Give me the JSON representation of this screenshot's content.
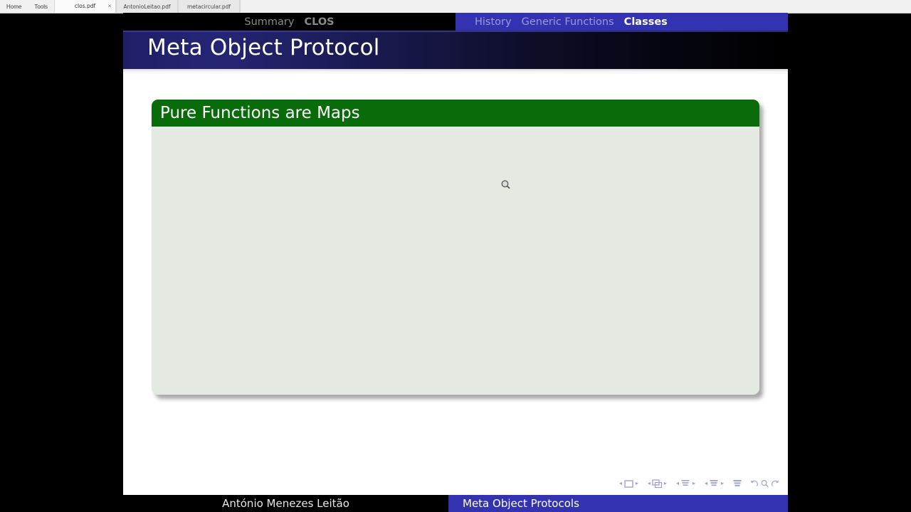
{
  "app": {
    "menu": [
      {
        "label": "Home",
        "name": "menu-home"
      },
      {
        "label": "Tools",
        "name": "menu-tools"
      }
    ],
    "tabs": [
      {
        "label": "clos.pdf",
        "active": true,
        "close": "×"
      },
      {
        "label": "AntonioLeitao.pdf",
        "active": false,
        "close": ""
      },
      {
        "label": "metacircular.pdf",
        "active": false,
        "close": ""
      }
    ]
  },
  "slide": {
    "navigation": {
      "sections": [
        {
          "label": "Summary",
          "active": false
        },
        {
          "label": "CLOS",
          "active": true
        }
      ],
      "subsections": [
        {
          "label": "History",
          "active": false
        },
        {
          "label": "Generic Functions",
          "active": false
        },
        {
          "label": "Classes",
          "active": true
        }
      ]
    },
    "frame_title": "Meta Object Protocol",
    "block": {
      "title": "Pure Functions are Maps",
      "body": ""
    },
    "footer": {
      "author": "António Menezes Leitão",
      "title": "Meta Object Protocols"
    },
    "nav_symbols": [
      {
        "name": "slide-navigation",
        "icon": "rectangle"
      },
      {
        "name": "frame-navigation",
        "icon": "stacked-rectangles"
      },
      {
        "name": "subsection-navigation",
        "icon": "lines-small"
      },
      {
        "name": "section-navigation",
        "icon": "lines-medium"
      },
      {
        "name": "document-navigation",
        "icon": "lines-large"
      },
      {
        "name": "back-navigation",
        "icon": "undo-arrow"
      },
      {
        "name": "search-navigation",
        "icon": "magnifier"
      },
      {
        "name": "forward-navigation",
        "icon": "redo-arrow"
      }
    ]
  },
  "colors": {
    "structure_blue": "#3333b2",
    "block_green": "#0a6b0a",
    "block_body": "#e4eae2",
    "title_gradient_start": "#1f1f66",
    "title_gradient_end": "#000000",
    "nav_inactive": "#9a9ad6",
    "page_background": "#ffffff",
    "desktop_background": "#000000"
  }
}
